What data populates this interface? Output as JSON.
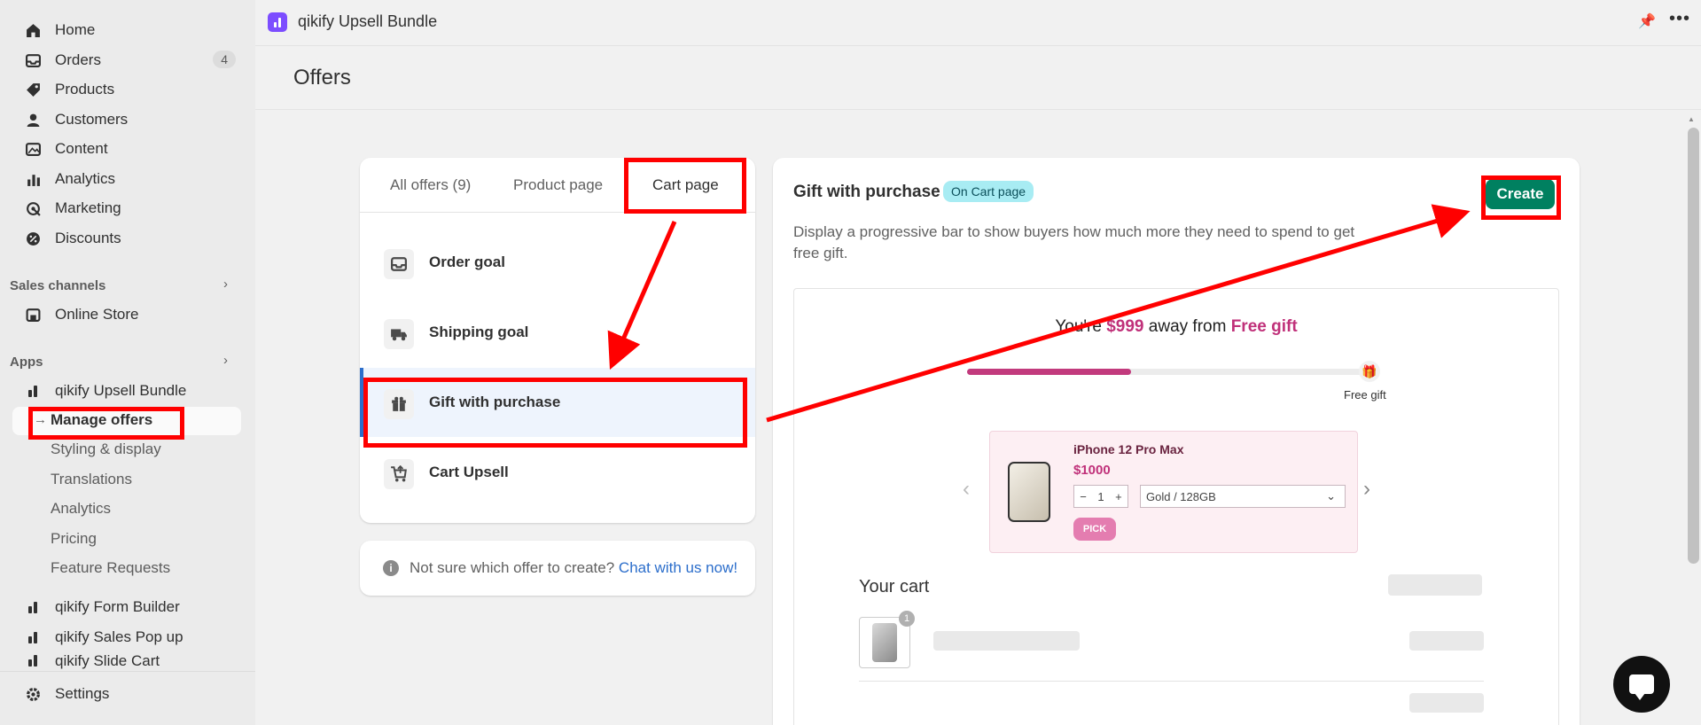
{
  "sidebar": {
    "nav": [
      {
        "label": "Home",
        "icon": "home-icon"
      },
      {
        "label": "Orders",
        "icon": "inbox-icon",
        "badge": "4"
      },
      {
        "label": "Products",
        "icon": "tag-icon"
      },
      {
        "label": "Customers",
        "icon": "person-icon"
      },
      {
        "label": "Content",
        "icon": "image-icon"
      },
      {
        "label": "Analytics",
        "icon": "bar-chart-icon"
      },
      {
        "label": "Marketing",
        "icon": "target-icon"
      },
      {
        "label": "Discounts",
        "icon": "discount-icon"
      }
    ],
    "sales_channels_label": "Sales channels",
    "online_store": "Online Store",
    "apps_label": "Apps",
    "app_current": "qikify Upsell Bundle",
    "app_subitems": {
      "active": "Manage offers",
      "items": [
        "Styling & display",
        "Translations",
        "Analytics",
        "Pricing",
        "Feature Requests"
      ]
    },
    "other_apps": [
      "qikify Form Builder",
      "qikify Sales Pop up",
      "qikify Slide Cart"
    ],
    "settings": "Settings"
  },
  "topbar": {
    "app_title": "qikify Upsell Bundle"
  },
  "page": {
    "title": "Offers"
  },
  "tabs": {
    "all": "All offers (9)",
    "product": "Product page",
    "cart": "Cart page"
  },
  "offers": [
    {
      "label": "Order goal",
      "icon": "inbox-icon"
    },
    {
      "label": "Shipping goal",
      "icon": "truck-icon"
    },
    {
      "label": "Gift with purchase",
      "icon": "gift-icon"
    },
    {
      "label": "Cart Upsell",
      "icon": "cart-icon"
    }
  ],
  "help": {
    "text": "Not sure which offer to create? ",
    "link": "Chat with us now!"
  },
  "detail": {
    "title": "Gift with purchase",
    "badge": "On Cart page",
    "description": "Display a progressive bar to show buyers how much more they need to spend to get free gift.",
    "create_label": "Create"
  },
  "preview": {
    "headline_pre": "You're ",
    "headline_amount": "$999",
    "headline_mid": " away from ",
    "headline_gift": "Free gift",
    "progress": 0.41,
    "gift_label": "Free gift",
    "product_name": "iPhone 12 Pro Max",
    "product_price": "$1000",
    "qty_minus": "−",
    "qty": "1",
    "qty_plus": "+",
    "variant": "Gold / 128GB",
    "pick_label": "PICK",
    "cart_title": "Your cart",
    "cart_item_badge": "1"
  },
  "colors": {
    "accent": "#008060",
    "annotation": "#ff0000",
    "highlight": "#c0317a"
  }
}
